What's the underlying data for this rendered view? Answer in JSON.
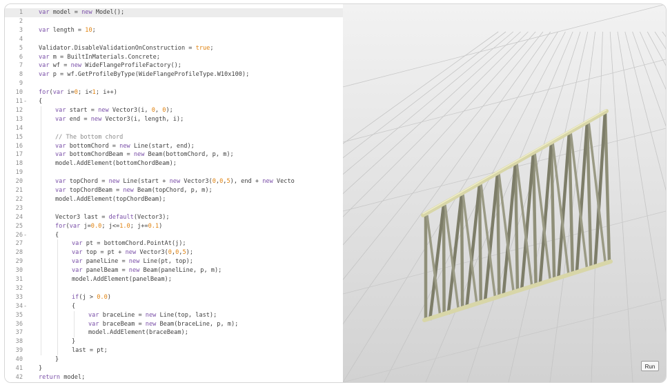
{
  "editor": {
    "lines": [
      {
        "num": "1",
        "fold": "",
        "indent": 0,
        "tokens": [
          {
            "t": "var",
            "c": "kw"
          },
          {
            "t": " model = "
          },
          {
            "t": "new",
            "c": "kw"
          },
          {
            "t": " Model();"
          }
        ]
      },
      {
        "num": "2",
        "fold": "",
        "indent": 0,
        "tokens": []
      },
      {
        "num": "3",
        "fold": "",
        "indent": 0,
        "tokens": [
          {
            "t": "var",
            "c": "kw"
          },
          {
            "t": " length = "
          },
          {
            "t": "10",
            "c": "num"
          },
          {
            "t": ";"
          }
        ]
      },
      {
        "num": "4",
        "fold": "",
        "indent": 0,
        "tokens": []
      },
      {
        "num": "5",
        "fold": "",
        "indent": 0,
        "tokens": [
          {
            "t": "Validator.DisableValidationOnConstruction = "
          },
          {
            "t": "true",
            "c": "num"
          },
          {
            "t": ";"
          }
        ]
      },
      {
        "num": "6",
        "fold": "",
        "indent": 0,
        "tokens": [
          {
            "t": "var",
            "c": "kw"
          },
          {
            "t": " m = BuiltInMaterials.Concrete;"
          }
        ]
      },
      {
        "num": "7",
        "fold": "",
        "indent": 0,
        "tokens": [
          {
            "t": "var",
            "c": "kw"
          },
          {
            "t": " wf = "
          },
          {
            "t": "new",
            "c": "kw"
          },
          {
            "t": " WideFlangeProfileFactory();"
          }
        ]
      },
      {
        "num": "8",
        "fold": "",
        "indent": 0,
        "tokens": [
          {
            "t": "var",
            "c": "kw"
          },
          {
            "t": " p = wf.GetProfileByType(WideFlangeProfileType.W10x100);"
          }
        ]
      },
      {
        "num": "9",
        "fold": "",
        "indent": 0,
        "tokens": []
      },
      {
        "num": "10",
        "fold": "",
        "indent": 0,
        "tokens": [
          {
            "t": "for",
            "c": "kw"
          },
          {
            "t": "("
          },
          {
            "t": "var",
            "c": "kw"
          },
          {
            "t": " i="
          },
          {
            "t": "0",
            "c": "num"
          },
          {
            "t": "; i<"
          },
          {
            "t": "1",
            "c": "num"
          },
          {
            "t": "; i++)"
          }
        ]
      },
      {
        "num": "11",
        "fold": "-",
        "indent": 0,
        "tokens": [
          {
            "t": "{"
          }
        ]
      },
      {
        "num": "12",
        "fold": "",
        "indent": 1,
        "tokens": [
          {
            "t": "var",
            "c": "kw"
          },
          {
            "t": " start = "
          },
          {
            "t": "new",
            "c": "kw"
          },
          {
            "t": " Vector3(i, "
          },
          {
            "t": "0",
            "c": "num"
          },
          {
            "t": ", "
          },
          {
            "t": "0",
            "c": "num"
          },
          {
            "t": ");"
          }
        ]
      },
      {
        "num": "13",
        "fold": "",
        "indent": 1,
        "tokens": [
          {
            "t": "var",
            "c": "kw"
          },
          {
            "t": " end = "
          },
          {
            "t": "new",
            "c": "kw"
          },
          {
            "t": " Vector3(i, length, i);"
          }
        ]
      },
      {
        "num": "14",
        "fold": "",
        "indent": 1,
        "tokens": []
      },
      {
        "num": "15",
        "fold": "",
        "indent": 1,
        "tokens": [
          {
            "t": "// The bottom chord",
            "c": "cm"
          }
        ]
      },
      {
        "num": "16",
        "fold": "",
        "indent": 1,
        "tokens": [
          {
            "t": "var",
            "c": "kw"
          },
          {
            "t": " bottomChord = "
          },
          {
            "t": "new",
            "c": "kw"
          },
          {
            "t": " Line(start, end);"
          }
        ]
      },
      {
        "num": "17",
        "fold": "",
        "indent": 1,
        "tokens": [
          {
            "t": "var",
            "c": "kw"
          },
          {
            "t": " bottomChordBeam = "
          },
          {
            "t": "new",
            "c": "kw"
          },
          {
            "t": " Beam(bottomChord, p, m);"
          }
        ]
      },
      {
        "num": "18",
        "fold": "",
        "indent": 1,
        "tokens": [
          {
            "t": "model.AddElement(bottomChordBeam);"
          }
        ]
      },
      {
        "num": "19",
        "fold": "",
        "indent": 1,
        "tokens": []
      },
      {
        "num": "20",
        "fold": "",
        "indent": 1,
        "tokens": [
          {
            "t": "var",
            "c": "kw"
          },
          {
            "t": " topChord = "
          },
          {
            "t": "new",
            "c": "kw"
          },
          {
            "t": " Line(start + "
          },
          {
            "t": "new",
            "c": "kw"
          },
          {
            "t": " Vector3("
          },
          {
            "t": "0",
            "c": "num"
          },
          {
            "t": ","
          },
          {
            "t": "0",
            "c": "num"
          },
          {
            "t": ","
          },
          {
            "t": "5",
            "c": "num"
          },
          {
            "t": "), end + "
          },
          {
            "t": "new",
            "c": "kw"
          },
          {
            "t": " Vecto"
          }
        ]
      },
      {
        "num": "21",
        "fold": "",
        "indent": 1,
        "tokens": [
          {
            "t": "var",
            "c": "kw"
          },
          {
            "t": " topChordBeam = "
          },
          {
            "t": "new",
            "c": "kw"
          },
          {
            "t": " Beam(topChord, p, m);"
          }
        ]
      },
      {
        "num": "22",
        "fold": "",
        "indent": 1,
        "tokens": [
          {
            "t": "model.AddElement(topChordBeam);"
          }
        ]
      },
      {
        "num": "23",
        "fold": "",
        "indent": 1,
        "tokens": []
      },
      {
        "num": "24",
        "fold": "",
        "indent": 1,
        "tokens": [
          {
            "t": "Vector3 last = "
          },
          {
            "t": "default",
            "c": "kw"
          },
          {
            "t": "(Vector3);"
          }
        ]
      },
      {
        "num": "25",
        "fold": "",
        "indent": 1,
        "tokens": [
          {
            "t": "for",
            "c": "kw"
          },
          {
            "t": "("
          },
          {
            "t": "var",
            "c": "kw"
          },
          {
            "t": " j="
          },
          {
            "t": "0.0",
            "c": "num"
          },
          {
            "t": "; j<="
          },
          {
            "t": "1.0",
            "c": "num"
          },
          {
            "t": "; j+="
          },
          {
            "t": "0.1",
            "c": "num"
          },
          {
            "t": ")"
          }
        ]
      },
      {
        "num": "26",
        "fold": "-",
        "indent": 1,
        "tokens": [
          {
            "t": "{"
          }
        ]
      },
      {
        "num": "27",
        "fold": "",
        "indent": 2,
        "tokens": [
          {
            "t": "var",
            "c": "kw"
          },
          {
            "t": " pt = bottomChord.PointAt(j);"
          }
        ]
      },
      {
        "num": "28",
        "fold": "",
        "indent": 2,
        "tokens": [
          {
            "t": "var",
            "c": "kw"
          },
          {
            "t": " top = pt + "
          },
          {
            "t": "new",
            "c": "kw"
          },
          {
            "t": " Vector3("
          },
          {
            "t": "0",
            "c": "num"
          },
          {
            "t": ","
          },
          {
            "t": "0",
            "c": "num"
          },
          {
            "t": ","
          },
          {
            "t": "5",
            "c": "num"
          },
          {
            "t": ");"
          }
        ]
      },
      {
        "num": "29",
        "fold": "",
        "indent": 2,
        "tokens": [
          {
            "t": "var",
            "c": "kw"
          },
          {
            "t": " panelLine = "
          },
          {
            "t": "new",
            "c": "kw"
          },
          {
            "t": " Line(pt, top);"
          }
        ]
      },
      {
        "num": "30",
        "fold": "",
        "indent": 2,
        "tokens": [
          {
            "t": "var",
            "c": "kw"
          },
          {
            "t": " panelBeam = "
          },
          {
            "t": "new",
            "c": "kw"
          },
          {
            "t": " Beam(panelLine, p, m);"
          }
        ]
      },
      {
        "num": "31",
        "fold": "",
        "indent": 2,
        "tokens": [
          {
            "t": "model.AddElement(panelBeam);"
          }
        ]
      },
      {
        "num": "32",
        "fold": "",
        "indent": 2,
        "tokens": []
      },
      {
        "num": "33",
        "fold": "",
        "indent": 2,
        "tokens": [
          {
            "t": "if",
            "c": "kw"
          },
          {
            "t": "(j > "
          },
          {
            "t": "0.0",
            "c": "num"
          },
          {
            "t": ")"
          }
        ]
      },
      {
        "num": "34",
        "fold": "-",
        "indent": 2,
        "tokens": [
          {
            "t": "{"
          }
        ]
      },
      {
        "num": "35",
        "fold": "",
        "indent": 3,
        "tokens": [
          {
            "t": "var",
            "c": "kw"
          },
          {
            "t": " braceLine = "
          },
          {
            "t": "new",
            "c": "kw"
          },
          {
            "t": " Line(top, last);"
          }
        ]
      },
      {
        "num": "36",
        "fold": "",
        "indent": 3,
        "tokens": [
          {
            "t": "var",
            "c": "kw"
          },
          {
            "t": " braceBeam = "
          },
          {
            "t": "new",
            "c": "kw"
          },
          {
            "t": " Beam(braceLine, p, m);"
          }
        ]
      },
      {
        "num": "37",
        "fold": "",
        "indent": 3,
        "tokens": [
          {
            "t": "model.AddElement(braceBeam);"
          }
        ]
      },
      {
        "num": "38",
        "fold": "",
        "indent": 2,
        "tokens": [
          {
            "t": "}"
          }
        ]
      },
      {
        "num": "39",
        "fold": "",
        "indent": 2,
        "tokens": [
          {
            "t": "last = pt;"
          }
        ]
      },
      {
        "num": "40",
        "fold": "",
        "indent": 1,
        "tokens": [
          {
            "t": "}"
          }
        ]
      },
      {
        "num": "41",
        "fold": "",
        "indent": 0,
        "tokens": [
          {
            "t": "}"
          }
        ]
      },
      {
        "num": "42",
        "fold": "",
        "indent": 0,
        "tokens": [
          {
            "t": "return",
            "c": "kw"
          },
          {
            "t": " model;"
          }
        ]
      }
    ]
  },
  "viewport": {
    "content": "3d-truss-model",
    "panel_count": 10
  },
  "run_button": {
    "label": "Run"
  },
  "colors": {
    "keyword": "#7a4fa8",
    "number": "#e0820f",
    "comment": "#8a8a8a",
    "beam": "#8f8f78",
    "chord": "#d8d6a8"
  }
}
